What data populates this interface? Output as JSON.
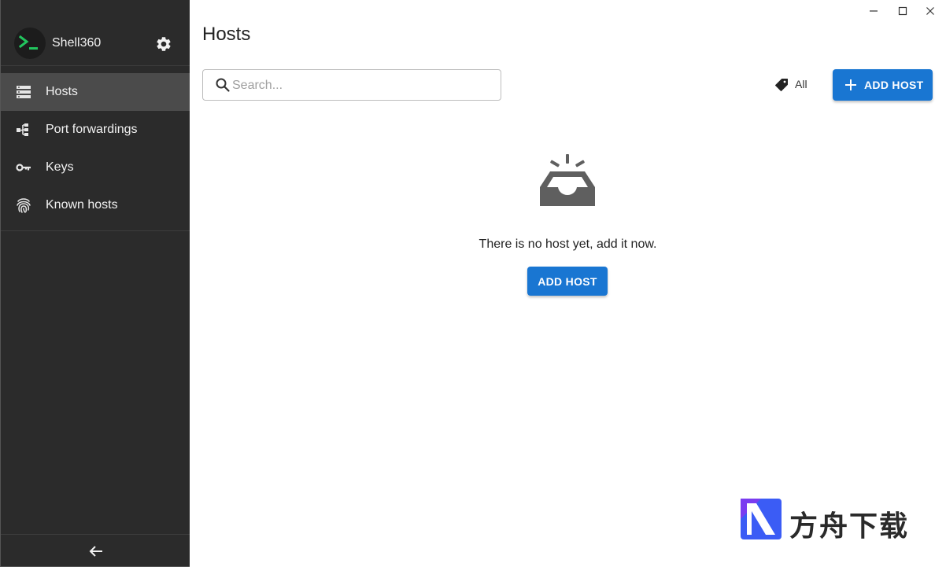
{
  "app": {
    "name": "Shell360"
  },
  "sidebar": {
    "items": [
      {
        "label": "Hosts",
        "icon": "server-icon",
        "active": true
      },
      {
        "label": "Port forwardings",
        "icon": "port-forward-icon",
        "active": false
      },
      {
        "label": "Keys",
        "icon": "key-icon",
        "active": false
      },
      {
        "label": "Known hosts",
        "icon": "fingerprint-icon",
        "active": false
      }
    ],
    "collapse_icon": "arrow-left-icon"
  },
  "main": {
    "title": "Hosts",
    "search": {
      "placeholder": "Search...",
      "value": ""
    },
    "tag_filter": {
      "label": "All",
      "icon": "tag-icon"
    },
    "add_button_label": "ADD HOST",
    "empty_state": {
      "icon": "inbox-icon",
      "message": "There is no host yet, add it now.",
      "button_label": "ADD HOST"
    }
  },
  "watermark": {
    "text": "方舟下载"
  },
  "colors": {
    "sidebar_bg": "#2b2b2b",
    "sidebar_active": "#4b4b4b",
    "primary": "#1976d2",
    "logo_green": "#22c55e"
  }
}
